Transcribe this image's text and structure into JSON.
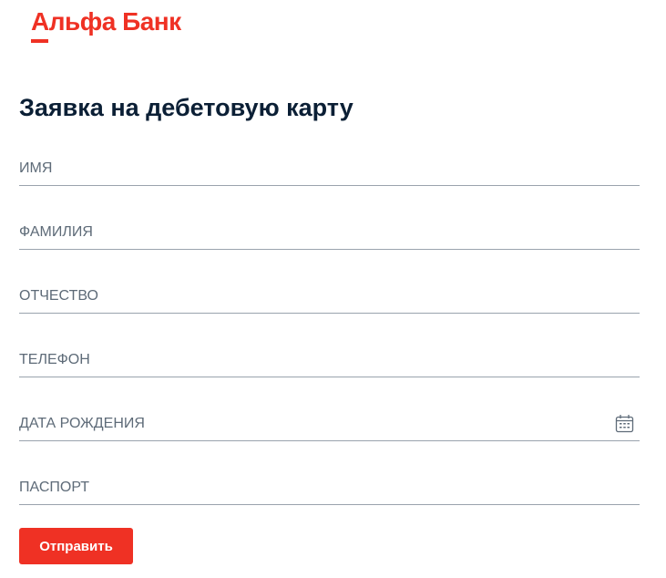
{
  "brand": {
    "name": "Альфа Банк",
    "accent_color": "#ef3124"
  },
  "page": {
    "title": "Заявка на дебетовую карту"
  },
  "form": {
    "fields": [
      {
        "placeholder": "ИМЯ",
        "value": ""
      },
      {
        "placeholder": "ФАМИЛИЯ",
        "value": ""
      },
      {
        "placeholder": "ОТЧЕСТВО",
        "value": ""
      },
      {
        "placeholder": "ТЕЛЕФОН",
        "value": ""
      },
      {
        "placeholder": "ДАТА РОЖДЕНИЯ",
        "value": "",
        "icon": "calendar-icon"
      },
      {
        "placeholder": "ПАСПОРТ",
        "value": ""
      }
    ],
    "submit_label": "Отправить"
  }
}
